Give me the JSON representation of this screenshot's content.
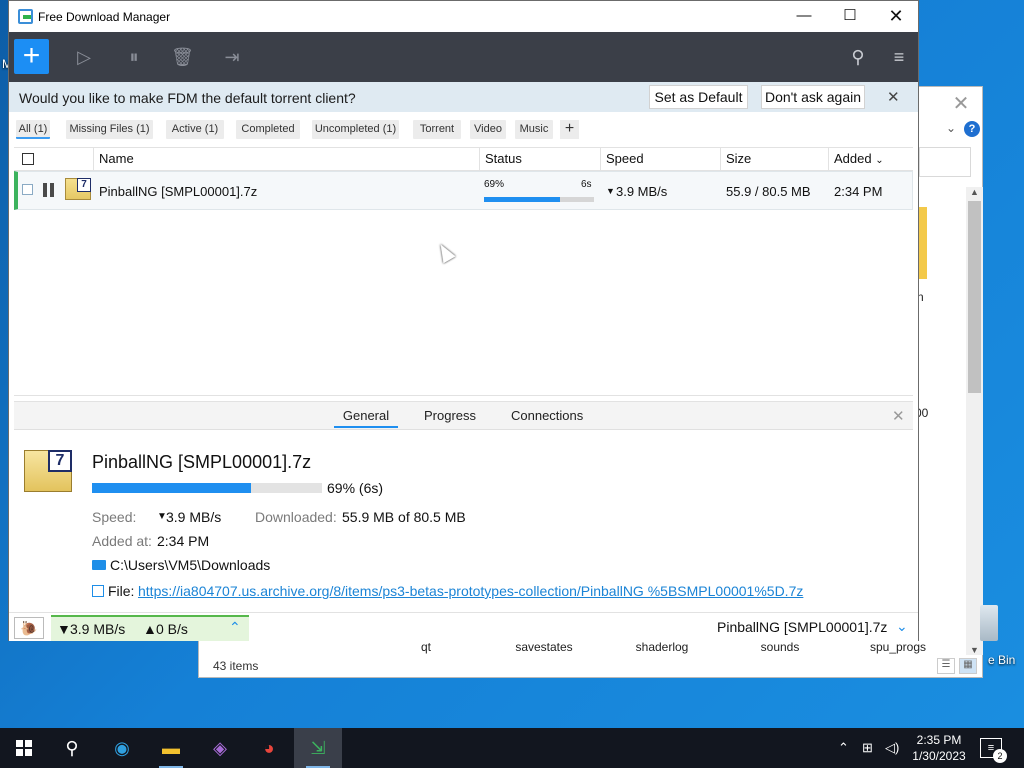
{
  "window": {
    "title": "Free Download Manager"
  },
  "banner": {
    "question": "Would you like to make FDM the default torrent client?",
    "set_default": "Set as Default",
    "dont_ask": "Don't ask again"
  },
  "filters": [
    "All (1)",
    "Missing Files (1)",
    "Active (1)",
    "Completed",
    "Uncompleted (1)",
    "Torrent",
    "Video",
    "Music"
  ],
  "columns": {
    "name": "Name",
    "status": "Status",
    "speed": "Speed",
    "size": "Size",
    "added": "Added"
  },
  "download": {
    "name": "PinballNG [SMPL00001].7z",
    "percent_label": "69%",
    "eta": "6s",
    "progress": 0.69,
    "speed": "3.9 MB/s",
    "size": "55.9 / 80.5 MB",
    "added": "2:34 PM"
  },
  "details": {
    "tabs": [
      "General",
      "Progress",
      "Connections"
    ],
    "name": "PinballNG [SMPL00001].7z",
    "percent_eta": "69% (6s)",
    "speed_label": "Speed:",
    "speed_value": "3.9 MB/s",
    "downloaded_label": "Downloaded:",
    "downloaded_value": "55.9 MB of 80.5 MB",
    "added_label": "Added at:",
    "added_value": "2:34 PM",
    "folder": "C:\\Users\\VM5\\Downloads",
    "file_label": "File:",
    "file_url": "https://ia804707.us.archive.org/8/items/ps3-betas-prototypes-collection/PinballNG %5BSMPL00001%5D.7z"
  },
  "statusbar": {
    "down_speed": "3.9 MB/s",
    "up_speed": "0 B/s",
    "current_file": "PinballNG [SMPL00001].7z"
  },
  "explorer": {
    "folders": [
      "qt",
      "savestates",
      "shaderlog",
      "sounds",
      "spu_progs"
    ],
    "items_count": "43 items",
    "fragment_n": "n",
    "fragment_00": "00"
  },
  "desktop": {
    "recycle_bin": "e Bin"
  },
  "taskbar": {
    "time": "2:35 PM",
    "date": "1/30/2023",
    "notifications": "2"
  },
  "icons": {
    "app": "fdm-icon",
    "add": "plus-icon",
    "resume": "play-icon",
    "pause_all": "pause-all-icon",
    "delete": "trash-icon",
    "move": "folder-move-icon",
    "search": "search-icon",
    "menu": "hamburger-icon"
  },
  "colors": {
    "accent": "#1f8ff0",
    "toolbar": "#3b3f48",
    "banner": "#dfeaf2",
    "active_row": "#3cb35e"
  }
}
